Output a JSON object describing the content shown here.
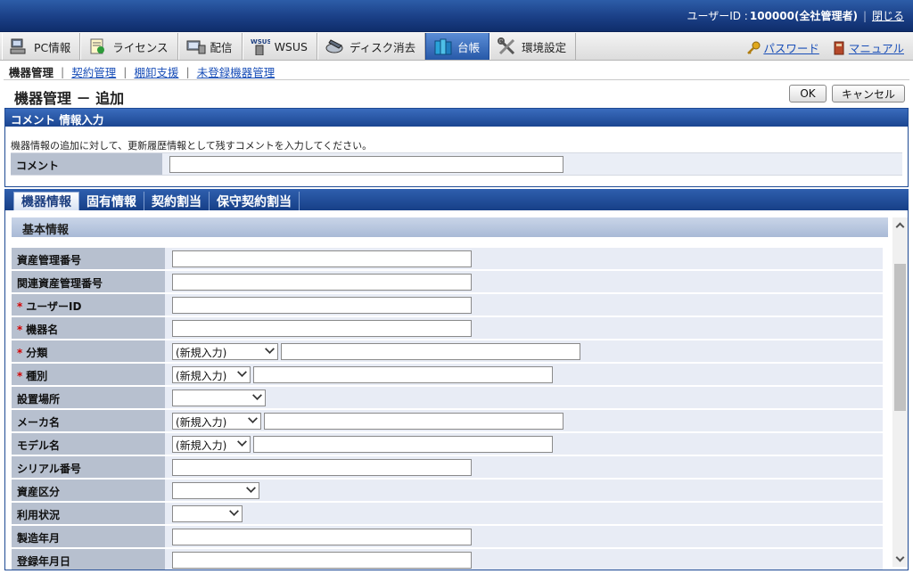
{
  "header": {
    "user_label": "ユーザーID : ",
    "user_value": "100000(全社管理者)",
    "close_link": "閉じる"
  },
  "main_nav": {
    "tabs": [
      {
        "label": "PC情報",
        "icon": "pc-icon"
      },
      {
        "label": "ライセンス",
        "icon": "license-icon"
      },
      {
        "label": "配信",
        "icon": "distribution-icon"
      },
      {
        "label": "WSUS",
        "icon": "wsus-icon"
      },
      {
        "label": "ディスク消去",
        "icon": "disk-erase-icon"
      },
      {
        "label": "台帳",
        "icon": "ledger-icon",
        "active": true
      },
      {
        "label": "環境設定",
        "icon": "tools-icon"
      }
    ],
    "password_link": "パスワード",
    "manual_link": "マニュアル"
  },
  "sub_nav": {
    "current": "機器管理",
    "links": [
      "契約管理",
      "棚卸支援",
      "未登録機器管理"
    ]
  },
  "page": {
    "title": "機器管理 － 追加",
    "ok_label": "OK",
    "cancel_label": "キャンセル"
  },
  "comment_panel": {
    "header": "コメント 情報入力",
    "description": "機器情報の追加に対して、更新履歴情報として残すコメントを入力してください。",
    "label": "コメント",
    "value": ""
  },
  "inner_tabs": [
    "機器情報",
    "固有情報",
    "契約割当",
    "保守契約割当"
  ],
  "section": {
    "title": "基本情報",
    "fields": [
      {
        "label": "資産管理番号",
        "required": false,
        "type": "text"
      },
      {
        "label": "関連資産管理番号",
        "required": false,
        "type": "text"
      },
      {
        "label": "ユーザーID",
        "required": true,
        "type": "text"
      },
      {
        "label": "機器名",
        "required": true,
        "type": "text"
      },
      {
        "label": "分類",
        "required": true,
        "type": "select+text",
        "select": "(新規入力)"
      },
      {
        "label": "種別",
        "required": true,
        "type": "select+text",
        "select": "(新規入力)"
      },
      {
        "label": "設置場所",
        "required": false,
        "type": "select",
        "select": ""
      },
      {
        "label": "メーカ名",
        "required": false,
        "type": "select+text",
        "select": "(新規入力)"
      },
      {
        "label": "モデル名",
        "required": false,
        "type": "select+text",
        "select": "(新規入力)"
      },
      {
        "label": "シリアル番号",
        "required": false,
        "type": "text"
      },
      {
        "label": "資産区分",
        "required": false,
        "type": "select",
        "select": ""
      },
      {
        "label": "利用状況",
        "required": false,
        "type": "select",
        "select": ""
      },
      {
        "label": "製造年月",
        "required": false,
        "type": "text"
      },
      {
        "label": "登録年月日",
        "required": false,
        "type": "text"
      }
    ]
  },
  "colors": {
    "header_blue": "#1a3f86",
    "active_tab": "#2759a8",
    "label_bg": "#b7c0cf",
    "row_bg": "#e8ecf5",
    "required": "#d40000",
    "link": "#1a4fb8"
  }
}
